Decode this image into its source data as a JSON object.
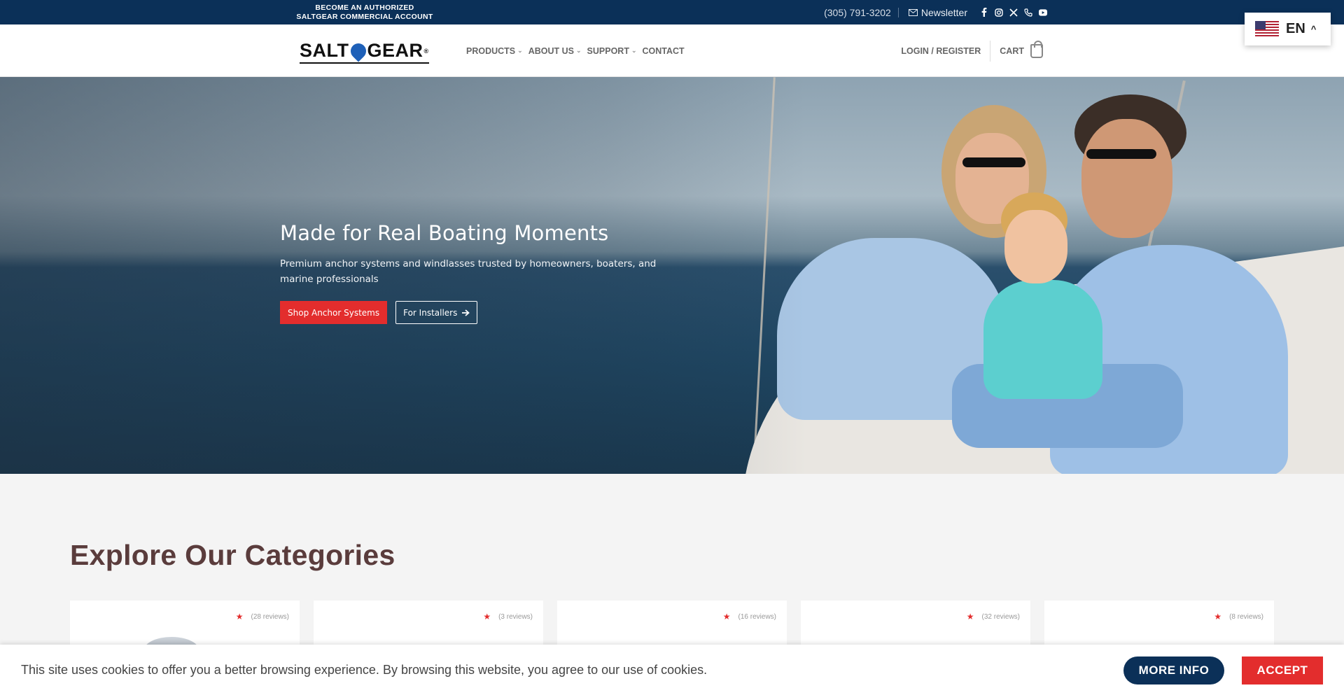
{
  "topbar": {
    "promo_line1": "BECOME AN AUTHORIZED",
    "promo_line2": "SALTGEAR COMMERCIAL ACCOUNT",
    "phone": "(305) 791-3202",
    "newsletter": "Newsletter",
    "social_icons": [
      "facebook-icon",
      "instagram-icon",
      "x-icon",
      "phone-icon",
      "youtube-icon"
    ]
  },
  "language": {
    "code": "EN"
  },
  "header": {
    "logo_left": "SALT",
    "logo_right": "GEAR",
    "nav": [
      {
        "label": "PRODUCTS",
        "has_dropdown": true
      },
      {
        "label": "ABOUT US",
        "has_dropdown": true
      },
      {
        "label": "SUPPORT",
        "has_dropdown": true
      },
      {
        "label": "CONTACT",
        "has_dropdown": false
      }
    ],
    "login": "LOGIN / REGISTER",
    "cart": "CART"
  },
  "hero": {
    "title": "Made for Real Boating Moments",
    "subtitle": "Premium anchor systems and windlasses trusted by homeowners, boaters, and marine professionals",
    "primary_button": "Shop Anchor Systems",
    "secondary_button": "For Installers"
  },
  "categories": {
    "title": "Explore Our Categories",
    "cards": [
      {
        "reviews": "(28 reviews)"
      },
      {
        "reviews": "(3 reviews)"
      },
      {
        "reviews": "(16 reviews)"
      },
      {
        "reviews": "(32 reviews)"
      },
      {
        "reviews": "(8 reviews)"
      }
    ]
  },
  "cookie": {
    "message": "This site uses cookies to offer you a better browsing experience. By browsing this website, you agree to our use of cookies.",
    "more_info": "MORE INFO",
    "accept": "ACCEPT"
  },
  "colors": {
    "navy": "#0b3058",
    "accent_red": "#e32d2d"
  }
}
